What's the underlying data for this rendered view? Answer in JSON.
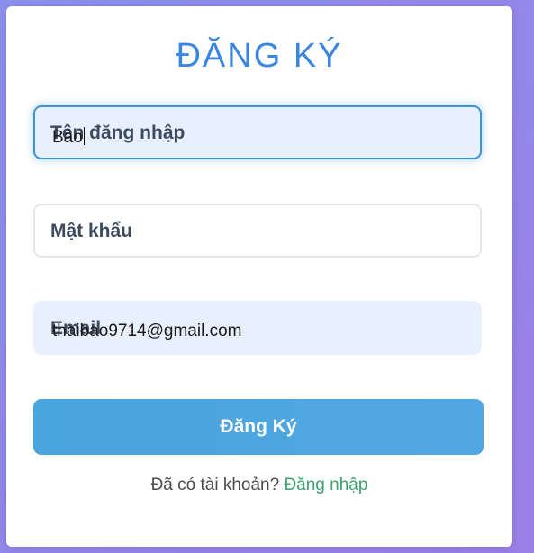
{
  "form": {
    "title": "ĐĂNG KÝ",
    "username": {
      "placeholder": "Tên đăng nhập",
      "value": "Bảo"
    },
    "password": {
      "placeholder": "Mật khẩu",
      "value": ""
    },
    "email": {
      "placeholder": "Email",
      "value": "thaibao9714@gmail.com"
    },
    "submit_label": "Đăng Ký",
    "footer_text": "Đã có tài khoản?",
    "login_link": "Đăng nhập"
  },
  "colors": {
    "accent": "#3a86e0",
    "button": "#4aa4de",
    "link": "#3aa36f",
    "background": "#8b90ee"
  }
}
